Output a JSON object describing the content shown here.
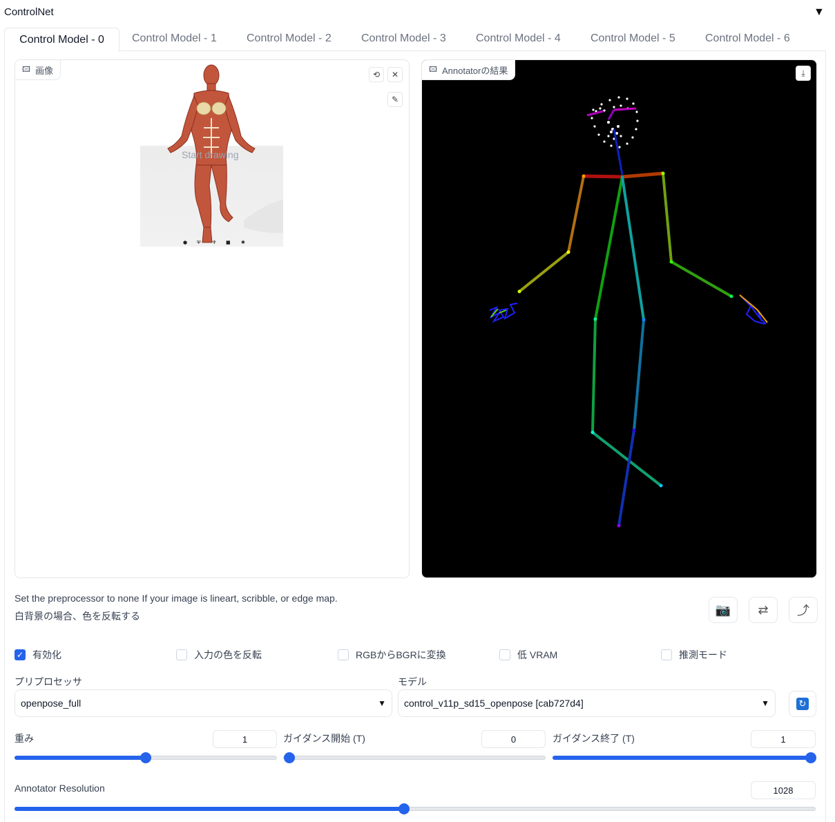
{
  "section_title": "ControlNet",
  "tabs": [
    {
      "label": "Control Model - 0"
    },
    {
      "label": "Control Model - 1"
    },
    {
      "label": "Control Model - 2"
    },
    {
      "label": "Control Model - 3"
    },
    {
      "label": "Control Model - 4"
    },
    {
      "label": "Control Model - 5"
    },
    {
      "label": "Control Model - 6"
    }
  ],
  "image_panel": {
    "label": "画像",
    "overlay_text": "Start drawing",
    "icons": [
      "undo-icon",
      "close-icon",
      "brush-icon"
    ]
  },
  "result_panel": {
    "label": "Annotatorの結果",
    "icons": [
      "download-icon"
    ]
  },
  "notes": {
    "line1": "Set the preprocessor to none If your image is lineart, scribble, or edge map.",
    "line2": "白背景の場合、色を反転する"
  },
  "action_icons": [
    "camera-icon",
    "swap-icon",
    "send-icon"
  ],
  "checkboxes": [
    {
      "label": "有効化",
      "checked": true
    },
    {
      "label": "入力の色を反転",
      "checked": false
    },
    {
      "label": "RGBからBGRに変換",
      "checked": false
    },
    {
      "label": "低 VRAM",
      "checked": false
    },
    {
      "label": "推測モード",
      "checked": false
    }
  ],
  "preprocessor": {
    "label": "プリプロセッサ",
    "value": "openpose_full"
  },
  "model": {
    "label": "モデル",
    "value": "control_v11p_sd15_openpose [cab727d4]"
  },
  "sliders": {
    "weight": {
      "label": "重み",
      "value": "1",
      "fraction": 0.5
    },
    "guidance_start": {
      "label": "ガイダンス開始 (T)",
      "value": "0",
      "fraction": 0.0
    },
    "guidance_end": {
      "label": "ガイダンス終了 (T)",
      "value": "1",
      "fraction": 1.0
    },
    "annotator_resolution": {
      "label": "Annotator Resolution",
      "value": "1028",
      "fraction": 0.5
    }
  },
  "colors": {
    "accent": "#2563eb",
    "result_bg": "#000000"
  }
}
